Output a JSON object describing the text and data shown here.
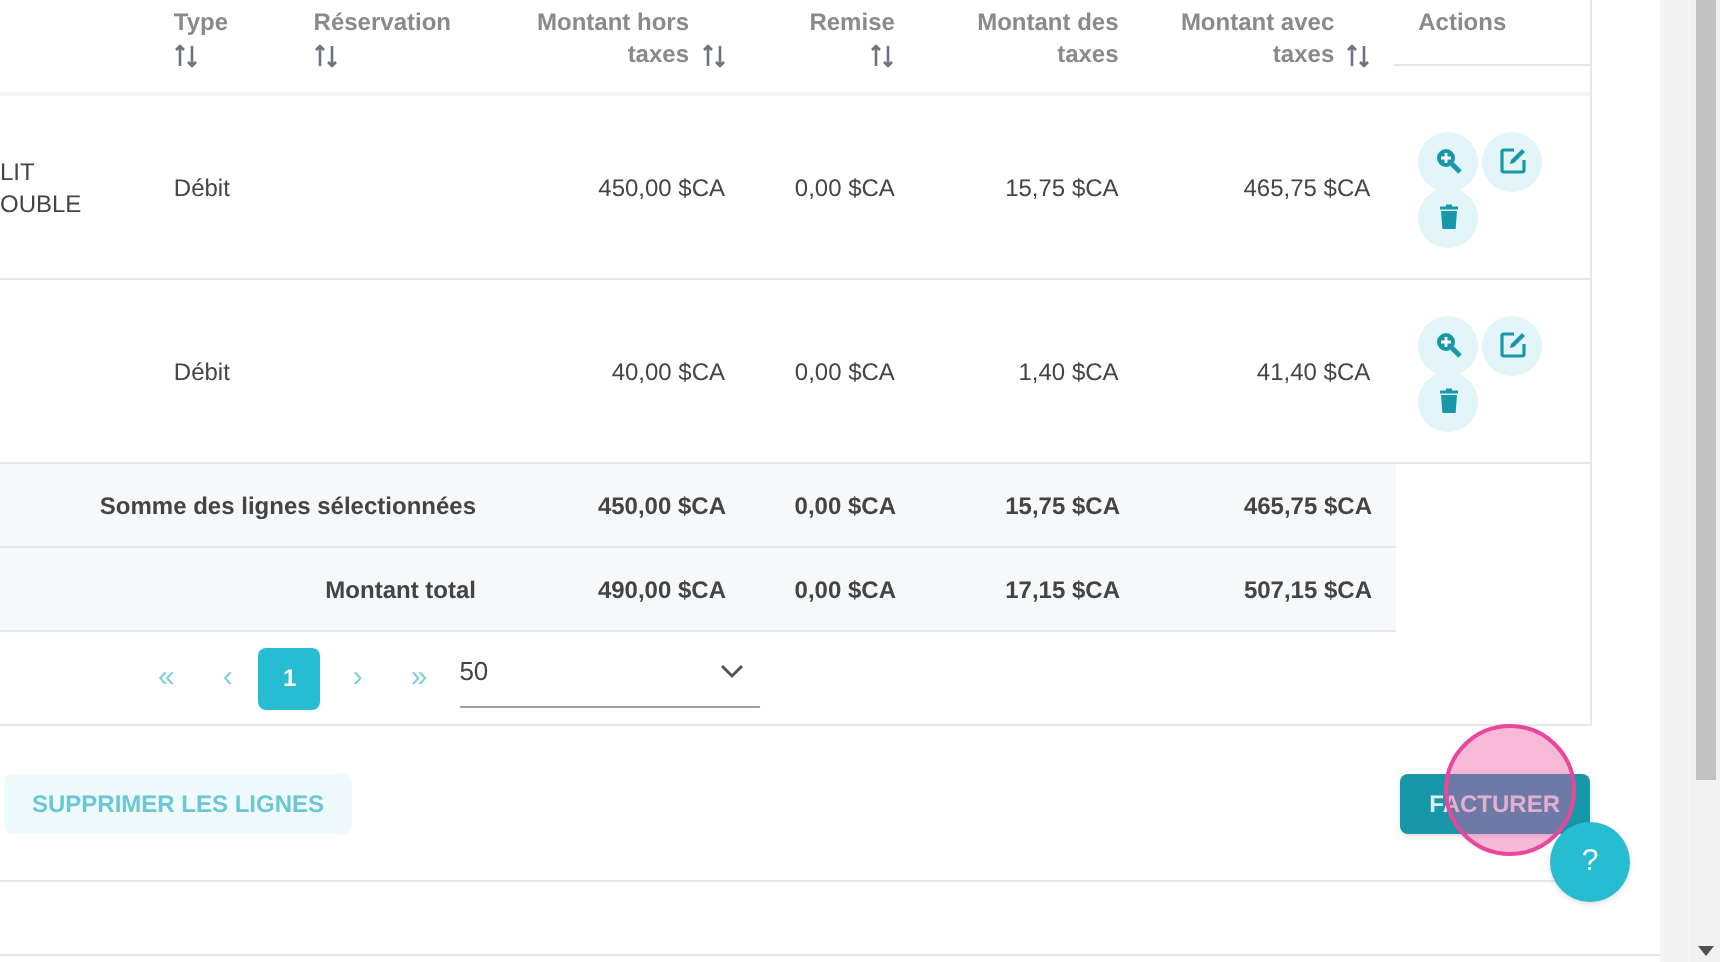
{
  "table": {
    "columns": [
      {
        "label": "Type",
        "sortable": true
      },
      {
        "label": "Réservation",
        "sortable": true
      },
      {
        "label": "Montant hors taxes",
        "sortable": true
      },
      {
        "label": "Remise",
        "sortable": true
      },
      {
        "label": "Montant des taxes",
        "sortable": false
      },
      {
        "label": "Montant avec taxes",
        "sortable": true
      },
      {
        "label": "Actions",
        "sortable": false
      }
    ],
    "rows": [
      {
        "column_1": "LIT OUBLE",
        "type": "Débit",
        "amount_excl_tax": "450,00 $CA",
        "discount": "0,00 $CA",
        "tax": "15,75 $CA",
        "amount_incl_tax": "465,75 $CA"
      },
      {
        "type": "Débit",
        "amount_excl_tax": "40,00 $CA",
        "discount": "0,00 $CA",
        "tax": "1,40 $CA",
        "amount_incl_tax": "41,40 $CA"
      }
    ],
    "totals": [
      {
        "label": "Somme des lignes sélectionnées",
        "amount_excl_tax": "450,00 $CA",
        "discount": "0,00 $CA",
        "tax": "15,75 $CA",
        "amount_incl_tax": "465,75 $CA"
      },
      {
        "label": "Montant total",
        "amount_excl_tax": "490,00 $CA",
        "discount": "0,00 $CA",
        "tax": "17,15 $CA",
        "amount_incl_tax": "507,15 $CA"
      }
    ]
  },
  "pagination": {
    "first": "«",
    "prev": "‹",
    "pages": [
      {
        "label": "1",
        "selected": true
      }
    ],
    "next": "›",
    "last": "»",
    "page_size": "50"
  },
  "buttons": {
    "delete_lines": "SUPPRIMER LES LIGNES",
    "invoice": "FACTURER"
  },
  "help_button": "?"
}
